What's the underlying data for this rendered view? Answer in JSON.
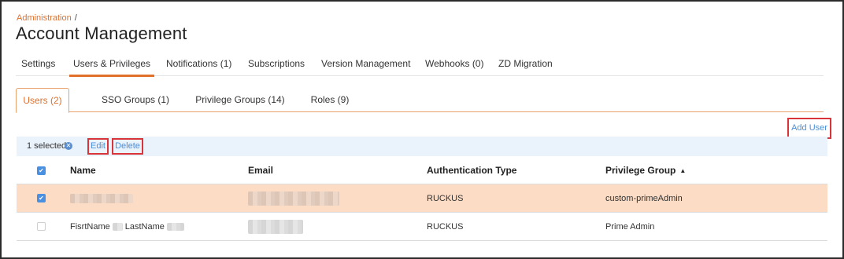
{
  "breadcrumb": {
    "link": "Administration",
    "separator": "/"
  },
  "page_title": "Account Management",
  "main_tabs": [
    {
      "label": "Settings",
      "active": false
    },
    {
      "label": "Users & Privileges",
      "active": true
    },
    {
      "label": "Notifications (1)",
      "active": false
    },
    {
      "label": "Subscriptions",
      "active": false
    },
    {
      "label": "Version Management",
      "active": false
    },
    {
      "label": "Webhooks (0)",
      "active": false
    },
    {
      "label": "ZD Migration",
      "active": false
    }
  ],
  "sub_tabs": [
    {
      "label": "Users (2)",
      "active": true
    },
    {
      "label": "SSO Groups (1)",
      "active": false
    },
    {
      "label": "Privilege Groups (14)",
      "active": false
    },
    {
      "label": "Roles (9)",
      "active": false
    }
  ],
  "actions": {
    "add_user": "Add User"
  },
  "bulk_bar": {
    "count": "1 selected",
    "edit": "Edit",
    "delete": "Delete"
  },
  "table": {
    "columns": [
      "Name",
      "Email",
      "Authentication Type",
      "Privilege Group"
    ],
    "sort": {
      "column": "Privilege Group",
      "direction": "ascending"
    },
    "rows": [
      {
        "checked": true,
        "name_first": "",
        "name_last": "",
        "auth": "RUCKUS",
        "group": "custom-primeAdmin"
      },
      {
        "checked": false,
        "name_first": "FisrtName",
        "name_last": "LastName",
        "auth": "RUCKUS",
        "group": "Prime Admin"
      }
    ]
  },
  "colors": {
    "accent": "#e0702a",
    "link": "#4a8fd8",
    "highlight_box": "#d9343a",
    "selected_row": "#fcdcc4",
    "bulk_bar": "#eaf2fb"
  },
  "icons": {
    "clear_selection": "close-circle-icon",
    "sort": "sort-ascending-icon",
    "check": "check-icon"
  }
}
